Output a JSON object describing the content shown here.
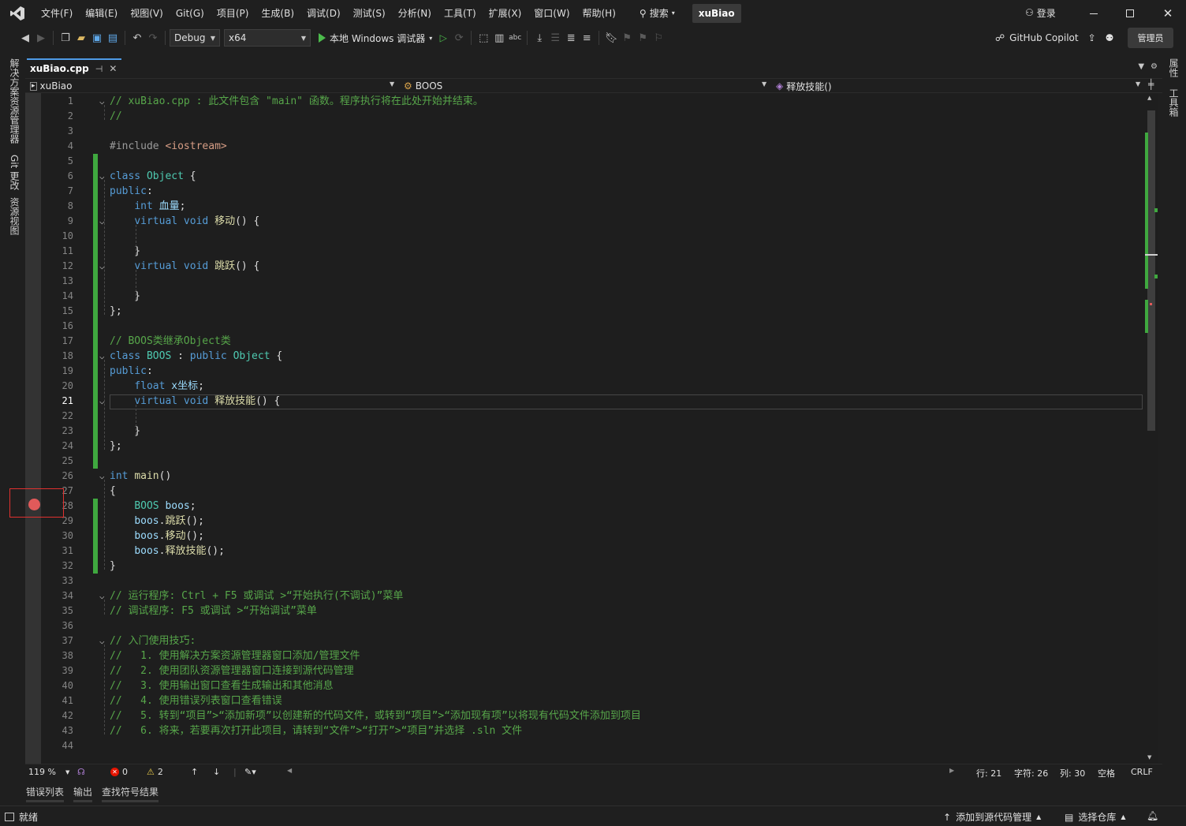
{
  "menubar": {
    "items": [
      "文件(F)",
      "编辑(E)",
      "视图(V)",
      "Git(G)",
      "项目(P)",
      "生成(B)",
      "调试(D)",
      "测试(S)",
      "分析(N)",
      "工具(T)",
      "扩展(X)",
      "窗口(W)",
      "帮助(H)"
    ],
    "search_label": "搜索",
    "solution_name": "xuBiao",
    "login_label": "登录"
  },
  "toolbar": {
    "config": "Debug",
    "platform": "x64",
    "run_label": "本地 Windows 调试器",
    "copilot_label": "GitHub Copilot",
    "admin_label": "管理员"
  },
  "left_rail": {
    "tabs": [
      "解决方案资源管理器",
      "Git 更改",
      "资源视图"
    ]
  },
  "right_rail": {
    "tabs": [
      "属性",
      "工具箱"
    ]
  },
  "document_tab": {
    "name": "xuBiao.cpp"
  },
  "navbar": {
    "project": "xuBiao",
    "scope": "BOOS",
    "member": "释放技能()"
  },
  "editor": {
    "current_line": 21,
    "breakpoint_line": 28,
    "lines": [
      {
        "n": 1,
        "fold": "⌵",
        "code": [
          [
            "com",
            "// xuBiao.cpp : 此文件包含 \"main\" 函数。程序执行将在此处开始并结束。"
          ]
        ]
      },
      {
        "n": 2,
        "code": [
          [
            "com",
            "//"
          ]
        ]
      },
      {
        "n": 3,
        "code": []
      },
      {
        "n": 4,
        "code": [
          [
            "pp",
            "#include "
          ],
          [
            "str",
            "<iostream>"
          ]
        ]
      },
      {
        "n": 5,
        "code": []
      },
      {
        "n": 6,
        "fold": "⌵",
        "code": [
          [
            "kw",
            "class "
          ],
          [
            "ty",
            "Object"
          ],
          [
            "pl",
            " {"
          ]
        ]
      },
      {
        "n": 7,
        "code": [
          [
            "kw",
            "public"
          ],
          [
            "pl",
            ":"
          ]
        ]
      },
      {
        "n": 8,
        "code": [
          [
            "pl",
            "    "
          ],
          [
            "kw",
            "int"
          ],
          [
            "pl",
            " "
          ],
          [
            "var",
            "血量"
          ],
          [
            "pl",
            ";"
          ]
        ]
      },
      {
        "n": 9,
        "fold": "⌵",
        "code": [
          [
            "pl",
            "    "
          ],
          [
            "kw",
            "virtual void"
          ],
          [
            "pl",
            " "
          ],
          [
            "fn",
            "移动"
          ],
          [
            "pl",
            "() {"
          ]
        ]
      },
      {
        "n": 10,
        "code": []
      },
      {
        "n": 11,
        "code": [
          [
            "pl",
            "    }"
          ]
        ]
      },
      {
        "n": 12,
        "fold": "⌵",
        "code": [
          [
            "pl",
            "    "
          ],
          [
            "kw",
            "virtual void"
          ],
          [
            "pl",
            " "
          ],
          [
            "fn",
            "跳跃"
          ],
          [
            "pl",
            "() {"
          ]
        ]
      },
      {
        "n": 13,
        "code": []
      },
      {
        "n": 14,
        "code": [
          [
            "pl",
            "    }"
          ]
        ]
      },
      {
        "n": 15,
        "code": [
          [
            "pl",
            "};"
          ]
        ]
      },
      {
        "n": 16,
        "code": []
      },
      {
        "n": 17,
        "code": [
          [
            "com",
            "// BOOS类继承Object类"
          ]
        ]
      },
      {
        "n": 18,
        "fold": "⌵",
        "code": [
          [
            "kw",
            "class "
          ],
          [
            "ty",
            "BOOS"
          ],
          [
            "pl",
            " : "
          ],
          [
            "kw",
            "public "
          ],
          [
            "ty",
            "Object"
          ],
          [
            "pl",
            " {"
          ]
        ]
      },
      {
        "n": 19,
        "code": [
          [
            "kw",
            "public"
          ],
          [
            "pl",
            ":"
          ]
        ]
      },
      {
        "n": 20,
        "code": [
          [
            "pl",
            "    "
          ],
          [
            "kw",
            "float"
          ],
          [
            "pl",
            " "
          ],
          [
            "var",
            "x坐标"
          ],
          [
            "pl",
            ";"
          ]
        ]
      },
      {
        "n": 21,
        "fold": "⌵",
        "code": [
          [
            "pl",
            "    "
          ],
          [
            "kw",
            "virtual void"
          ],
          [
            "pl",
            " "
          ],
          [
            "fn",
            "释放技能"
          ],
          [
            "pl",
            "() {"
          ]
        ]
      },
      {
        "n": 22,
        "code": []
      },
      {
        "n": 23,
        "code": [
          [
            "pl",
            "    }"
          ]
        ]
      },
      {
        "n": 24,
        "code": [
          [
            "pl",
            "};"
          ]
        ]
      },
      {
        "n": 25,
        "code": []
      },
      {
        "n": 26,
        "fold": "⌵",
        "code": [
          [
            "kw",
            "int"
          ],
          [
            "pl",
            " "
          ],
          [
            "fn",
            "main"
          ],
          [
            "pl",
            "()"
          ]
        ]
      },
      {
        "n": 27,
        "code": [
          [
            "pl",
            "{"
          ]
        ]
      },
      {
        "n": 28,
        "code": [
          [
            "pl",
            "    "
          ],
          [
            "ty",
            "BOOS"
          ],
          [
            "pl",
            " "
          ],
          [
            "var",
            "boos"
          ],
          [
            "pl",
            ";"
          ]
        ]
      },
      {
        "n": 29,
        "code": [
          [
            "pl",
            "    "
          ],
          [
            "var",
            "boos"
          ],
          [
            "pl",
            "."
          ],
          [
            "fn",
            "跳跃"
          ],
          [
            "pl",
            "();"
          ]
        ]
      },
      {
        "n": 30,
        "code": [
          [
            "pl",
            "    "
          ],
          [
            "var",
            "boos"
          ],
          [
            "pl",
            "."
          ],
          [
            "fn",
            "移动"
          ],
          [
            "pl",
            "();"
          ]
        ]
      },
      {
        "n": 31,
        "code": [
          [
            "pl",
            "    "
          ],
          [
            "var",
            "boos"
          ],
          [
            "pl",
            "."
          ],
          [
            "fn",
            "释放技能"
          ],
          [
            "pl",
            "();"
          ]
        ]
      },
      {
        "n": 32,
        "code": [
          [
            "pl",
            "}"
          ]
        ]
      },
      {
        "n": 33,
        "code": []
      },
      {
        "n": 34,
        "fold": "⌵",
        "code": [
          [
            "com",
            "// 运行程序: Ctrl + F5 或调试 >“开始执行(不调试)”菜单"
          ]
        ]
      },
      {
        "n": 35,
        "code": [
          [
            "com",
            "// 调试程序: F5 或调试 >“开始调试”菜单"
          ]
        ]
      },
      {
        "n": 36,
        "code": []
      },
      {
        "n": 37,
        "fold": "⌵",
        "code": [
          [
            "com",
            "// 入门使用技巧:"
          ]
        ]
      },
      {
        "n": 38,
        "code": [
          [
            "com",
            "//   1. 使用解决方案资源管理器窗口添加/管理文件"
          ]
        ]
      },
      {
        "n": 39,
        "code": [
          [
            "com",
            "//   2. 使用团队资源管理器窗口连接到源代码管理"
          ]
        ]
      },
      {
        "n": 40,
        "code": [
          [
            "com",
            "//   3. 使用输出窗口查看生成输出和其他消息"
          ]
        ]
      },
      {
        "n": 41,
        "code": [
          [
            "com",
            "//   4. 使用错误列表窗口查看错误"
          ]
        ]
      },
      {
        "n": 42,
        "code": [
          [
            "com",
            "//   5. 转到“项目”>“添加新项”以创建新的代码文件，或转到“项目”>“添加现有项”以将现有代码文件添加到项目"
          ]
        ]
      },
      {
        "n": 43,
        "code": [
          [
            "com",
            "//   6. 将来，若要再次打开此项目，请转到“文件”>“打开”>“项目”并选择 .sln 文件"
          ]
        ]
      },
      {
        "n": 44,
        "code": []
      }
    ]
  },
  "editor_status": {
    "zoom": "119 %",
    "errors": "0",
    "warnings": "2",
    "line": "行: 21",
    "char": "字符: 26",
    "col": "列: 30",
    "whitespace": "空格",
    "eol": "CRLF"
  },
  "panel_tabs": [
    "错误列表",
    "输出",
    "查找符号结果"
  ],
  "statusbar": {
    "ready": "就绪",
    "source_control": "添加到源代码管理",
    "repo": "选择仓库"
  },
  "colors": {
    "accent": "#4e9ae6",
    "change_bar": "#3fa83f",
    "breakpoint": "#e05a5a",
    "highlight_frame": "#e0312f"
  }
}
